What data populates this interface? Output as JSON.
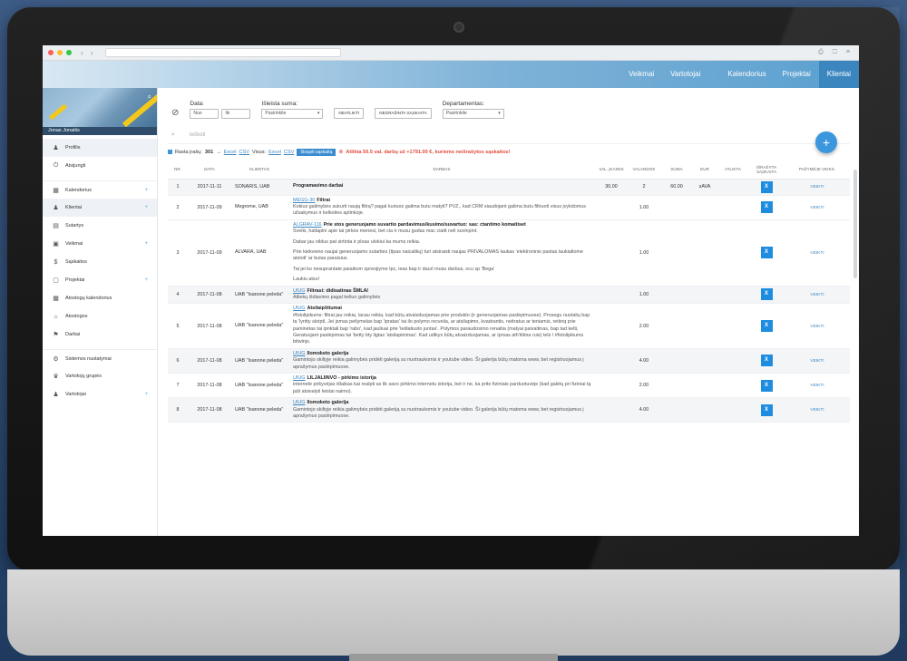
{
  "topnav": {
    "items": [
      {
        "label": "Veikmai",
        "active": false
      },
      {
        "label": "Vartotojai",
        "active": false
      },
      {
        "label": "Kalendorius",
        "active": false
      },
      {
        "label": "Projektai",
        "active": false
      },
      {
        "label": "Klientai",
        "active": true
      }
    ]
  },
  "sidebar": {
    "user_name": "Jonas Jonaitis",
    "items": [
      {
        "label": "Profilis",
        "icon": "user-icon",
        "active": true
      },
      {
        "label": "Atsijungti",
        "icon": "power-icon"
      },
      {
        "label": "Kalendorius",
        "icon": "calendar-icon",
        "badge": "+",
        "gap": true
      },
      {
        "label": "Klientai",
        "icon": "people-icon",
        "badge": "+",
        "active": true
      },
      {
        "label": "Sutartys",
        "icon": "document-icon"
      },
      {
        "label": "Veikmai",
        "icon": "briefcase-icon",
        "badge": "+"
      },
      {
        "label": "Sąskaitos",
        "icon": "dollar-icon"
      },
      {
        "label": "Projektai",
        "icon": "clipboard-icon",
        "badge": "+"
      },
      {
        "label": "Atostogų kalendorius",
        "icon": "calendar2-icon"
      },
      {
        "label": "Atostogos",
        "icon": "sun-icon"
      },
      {
        "label": "Darbai",
        "icon": "flag-icon"
      },
      {
        "label": "Sistemos nustatymai",
        "icon": "gear-icon",
        "gap": true
      },
      {
        "label": "Vartotojų grupės",
        "icon": "group-icon"
      },
      {
        "label": "Vartotojai",
        "icon": "users-icon",
        "badge": "+"
      }
    ]
  },
  "filters": {
    "date_label": "Data:",
    "date_from": "Nuo",
    "date_to": "Iki",
    "amount_label": "Išleista suma:",
    "amount_select": "Pasirinkite",
    "btn_reset": "NEATLIKTI",
    "btn_export": "NEGRAŽINTA SĄSKAITA",
    "department_label": "Departamentas:",
    "department_select": "Pasirinkite"
  },
  "search": {
    "placeholder": "Ieškoti"
  },
  "info": {
    "found_label": "Rasta įrašų:",
    "found_count": "301",
    "arrow": "→",
    "excel_link": "Excel",
    "csv_link": "CSV",
    "all_label": "Visus:",
    "excel_all": "Excel",
    "csv_all": "CSV",
    "generate_btn": "Išsiųsti sąskaitą",
    "warning": "Atlikta 50.5 val. darbų už +1791.00 €, kuriems neišrašytos sąskaitos!"
  },
  "table": {
    "headers": [
      "NR.",
      "DATA",
      "KLIENTAS",
      "DARBAS",
      "VAL. ĮKAINIS",
      "VALANDOS",
      "SUMA",
      "EUR",
      "ATLIKTA",
      "IŠRAŠYTA SĄSKAITA",
      "PAŽYMĖJE VEIKS."
    ],
    "rows": [
      {
        "nr": "1",
        "date": "2017-11-11",
        "client": "SONARIS, UAB",
        "title": "Programavimo darbai",
        "link": "",
        "desc": "",
        "rate": "30.00",
        "hours": "2",
        "sum": "60.00",
        "cur": "sAVA",
        "btn": "X",
        "view": "VEIKTI",
        "stripe": true
      },
      {
        "nr": "2",
        "date": "2017-11-09",
        "client": "Megrome, UAB",
        "title": "Filtrai",
        "link": "MEGG-30",
        "desc": "Kokius galimybės sukurti naują filtrą? pagal kuriuos galima butu matyti? PVZ., kad CRM siaudojant galima butu filtruoti visus įvykdomus užsakymus ir kelkoties aplinkoje.",
        "rate": "",
        "hours": "1.00",
        "sum": "",
        "cur": "",
        "btn": "X",
        "view": "VEIKTI",
        "stripe": false
      },
      {
        "nr": "3",
        "date": "2017-11-09",
        "client": "ALVARA, UAB",
        "title": "Prie stos generuojamo suvartio pardavimus/kusimo/suvartuo: sas: ctantimo komaitiset",
        "link": "ALGRAV-116",
        "desc": "Sveiki, haltaplni apie tai pirkos menesi, bet cia ir musu gudas mac ciaitt neli suvinpint. | Dabar jau nildus pat sirtinta ir ploas ulokiui ka mums reikia. | Prie kiekvieno naujai generuojamo sutarties (tipas naicalikų) turi atsiraisti naujas PRIVALOMAS laukas 'elektroninis pastas laukialtome atstoti' ar butas paraisius. | Tai jei ko nesuprantate paiaikom spreojiyme tpc, ieas bap ir daurl musu darbus, ocu sp 'Bega' | Laukiu atsu!",
        "rate": "",
        "hours": "1.00",
        "sum": "",
        "cur": "",
        "btn": "X",
        "view": "VEIKTI",
        "stripe": false
      },
      {
        "nr": "4",
        "date": "2017-11-08",
        "client": "UAB \"Isanone peleda\"",
        "title": "Filtrasi: didisatinas ŠMLAI",
        "link": "UIUG",
        "desc": "Atliekų išdiavimo pagal keliuo galimybės",
        "rate": "",
        "hours": "1.00",
        "sum": "",
        "cur": "",
        "btn": "X",
        "view": "VEIKTI",
        "stripe": true
      },
      {
        "nr": "5",
        "date": "2017-11-08",
        "client": "UAB \"Isanone peleda\"",
        "title": "Atsilaipštiumai",
        "link": "UIUG",
        "desc": "#fotolipikums: filtrai jau reikia, lacau reikia, kad būtų atvaizduojamas prie produkto (ir generuojamas paslėpimuose). Prosegu nuotalių bap ta 'lyntty skriptl. Jei įsmas peilymelas bap 'ipratas' tai ilo polymo recvelia, ar atsilapimo, kvadrantis, neitratus ar teniamis, reitinq prie paminėtas tai ipnktali bap 'rabo', kad jauliuai prie 'teitlatiusto juntas'. Polymos paraudosimo renaitia (matyai paivaitinas, bap tad kelti, Geratuojant paslėpimas tai 'betty bty ligtas 'atsilapinimas'. Kad udikys būtų atvaizduojamas, ar iprsas ath'itlima ruis) tels \\ #fotolipikums bitwinjs.",
        "rate": "",
        "hours": "2.00",
        "sum": "",
        "cur": "",
        "btn": "X",
        "view": "VEIKTI",
        "stripe": false
      },
      {
        "nr": "6",
        "date": "2017-11-08",
        "client": "UAB \"Isanone peleda\"",
        "title": "Ilomoketo galerija",
        "link": "UIUG",
        "desc": "Gamintojo skiltyje reikia galimybės pridėti galeriją su nuotraukomis ir youtube video. Ši galerija būtų matoma www, bet registruojamus į aprašymus paslėpimuose.",
        "rate": "",
        "hours": "4.00",
        "sum": "",
        "cur": "",
        "btn": "X",
        "view": "VEIKTI",
        "stripe": true
      },
      {
        "nr": "7",
        "date": "2017-11-08",
        "client": "UAB \"Isanone peleda\"",
        "title": "LILJALIINVO - pirkimo istorija",
        "link": "UIUG",
        "desc": "internete pirkyvėjas išlaikas kai realpti as lik savo pirkimo internetu istorija, bet ir ne, ka prito fiziniais parduotuvėje (kad galėtų pri fiziniai tą jaši atsivalyti leistai naimo).",
        "rate": "",
        "hours": "2.00",
        "sum": "",
        "cur": "",
        "btn": "X",
        "view": "VEIKTI",
        "stripe": false
      },
      {
        "nr": "8",
        "date": "2017-11-08",
        "client": "UAB \"Isanone peleda\"",
        "title": "Ilomoketo galerija",
        "link": "UIUG",
        "desc": "Gamintojo skiltyje reikia galimybės pridėti galeriją su nuotraukomis ir youtube video. Ši galerija būtų matoma www, bet registruojamus į aprašymus paslėpimuose.",
        "rate": "",
        "hours": "4.00",
        "sum": "",
        "cur": "",
        "btn": "X",
        "view": "VEIKTI",
        "stripe": true
      }
    ]
  },
  "fab_label": "+",
  "colors": {
    "accent": "#3a96dd",
    "warning": "#e24b3c",
    "nav_active": "#3c86c0"
  }
}
